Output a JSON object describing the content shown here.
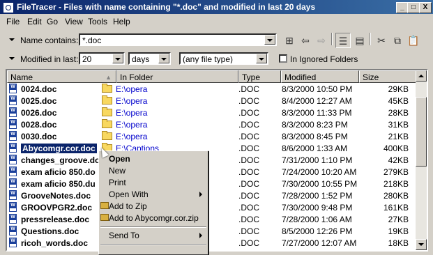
{
  "window": {
    "title": "FileTracer - Files with name containing  \"*.doc\" and modified in last 20 days",
    "min_label": "_",
    "max_label": "□",
    "close_label": "X"
  },
  "menu": [
    "File",
    "Edit",
    "Go",
    "View",
    "Tools",
    "Help"
  ],
  "filters": {
    "name_label": "Name contains:",
    "name_value": "*.doc",
    "modified_label": "Modified in last:",
    "modified_value": "20",
    "unit_value": "days",
    "type_value": "(any file type)",
    "ignored_label": "In Ignored Folders",
    "ignored_checked": false
  },
  "columns": [
    "Name",
    "In Folder",
    "Type",
    "Modified",
    "Size"
  ],
  "files": [
    {
      "name": "0024.doc",
      "folder": "E:\\opera",
      "type": ".DOC",
      "modified": "8/3/2000 10:50 PM",
      "size": "29KB"
    },
    {
      "name": "0025.doc",
      "folder": "E:\\opera",
      "type": ".DOC",
      "modified": "8/4/2000 12:27 AM",
      "size": "45KB"
    },
    {
      "name": "0026.doc",
      "folder": "E:\\opera",
      "type": ".DOC",
      "modified": "8/3/2000 11:33 PM",
      "size": "28KB"
    },
    {
      "name": "0028.doc",
      "folder": "E:\\opera",
      "type": ".DOC",
      "modified": "8/3/2000 8:23 PM",
      "size": "31KB"
    },
    {
      "name": "0030.doc",
      "folder": "E:\\opera",
      "type": ".DOC",
      "modified": "8/3/2000 8:45 PM",
      "size": "21KB"
    },
    {
      "name": "Abycomgr.cor.doc",
      "folder": "E:\\Captions",
      "type": ".DOC",
      "modified": "8/6/2000 1:33 AM",
      "size": "400KB"
    },
    {
      "name": "changes_groove.do",
      "folder": "",
      "type": ".DOC",
      "modified": "7/31/2000 1:10 PM",
      "size": "42KB"
    },
    {
      "name": "exam aficio 850.do",
      "folder": "",
      "type": ".DOC",
      "modified": "7/24/2000 10:20 AM",
      "size": "279KB"
    },
    {
      "name": "exam aficio 850.du",
      "folder": "",
      "type": ".DOC",
      "modified": "7/30/2000 10:55 PM",
      "size": "218KB"
    },
    {
      "name": "GrooveNotes.doc",
      "folder": "",
      "type": ".DOC",
      "modified": "7/28/2000 1:52 PM",
      "size": "280KB"
    },
    {
      "name": "GROOVPGR2.doc",
      "folder": "",
      "type": ".DOC",
      "modified": "7/30/2000 9:48 PM",
      "size": "161KB"
    },
    {
      "name": "pressrelease.doc",
      "folder": "al",
      "type": ".DOC",
      "modified": "7/28/2000 1:06 AM",
      "size": "27KB"
    },
    {
      "name": "Questions.doc",
      "folder": "",
      "type": ".DOC",
      "modified": "8/5/2000 12:26 PM",
      "size": "19KB"
    },
    {
      "name": "ricoh_words.doc",
      "folder": "",
      "type": ".DOC",
      "modified": "7/27/2000 12:07 AM",
      "size": "18KB"
    }
  ],
  "selected_file": "Abycomgr.cor.doc",
  "context_menu": {
    "open": "Open",
    "new": "New",
    "print": "Print",
    "open_with": "Open With",
    "add_zip": "Add to Zip",
    "add_named_zip": "Add to Abycomgr.cor.zip",
    "send_to": "Send To"
  }
}
